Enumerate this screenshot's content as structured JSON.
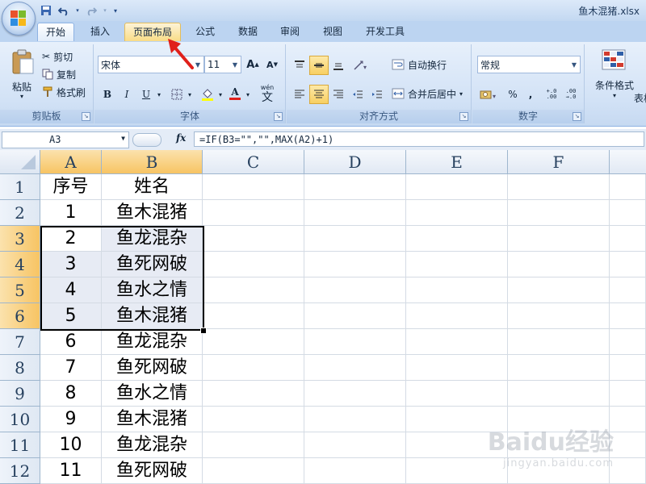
{
  "titlebar": {
    "filename": "鱼木混猪.xlsx"
  },
  "ribbon_tabs": [
    "开始",
    "插入",
    "页面布局",
    "公式",
    "数据",
    "审阅",
    "视图",
    "开发工具"
  ],
  "clipboard": {
    "paste": "粘贴",
    "cut": "剪切",
    "copy": "复制",
    "format_painter": "格式刷",
    "label": "剪贴板"
  },
  "font": {
    "name": "宋体",
    "size": "11",
    "grow": "A",
    "shrink": "A",
    "bold": "B",
    "italic": "I",
    "underline": "U",
    "font_color": "A",
    "phonetic": "wén",
    "phonetic_glyph": "文",
    "label": "字体"
  },
  "alignment": {
    "wrap_text": "自动换行",
    "merge_center": "合并后居中",
    "label": "对齐方式"
  },
  "number": {
    "format": "常规",
    "percent": "%",
    "comma": ",",
    "inc_decimal": "+.0\n.00",
    "dec_decimal": ".00\n→.0",
    "label": "数字"
  },
  "styles": {
    "conditional_format": "条件格式",
    "table_partial": "表格"
  },
  "formula_bar": {
    "name_box": "A3",
    "fx": "fx",
    "formula": "=IF(B3=\"\",\"\",MAX(A2)+1)"
  },
  "grid": {
    "columns": [
      "A",
      "B",
      "C",
      "D",
      "E",
      "F"
    ],
    "rows": [
      {
        "num": "1",
        "a": "序号",
        "b": "姓名"
      },
      {
        "num": "2",
        "a": "1",
        "b": "鱼木混猪"
      },
      {
        "num": "3",
        "a": "2",
        "b": "鱼龙混杂"
      },
      {
        "num": "4",
        "a": "3",
        "b": "鱼死网破"
      },
      {
        "num": "5",
        "a": "4",
        "b": "鱼水之情"
      },
      {
        "num": "6",
        "a": "5",
        "b": "鱼木混猪"
      },
      {
        "num": "7",
        "a": "6",
        "b": "鱼龙混杂"
      },
      {
        "num": "8",
        "a": "7",
        "b": "鱼死网破"
      },
      {
        "num": "9",
        "a": "8",
        "b": "鱼水之情"
      },
      {
        "num": "10",
        "a": "9",
        "b": "鱼木混猪"
      },
      {
        "num": "11",
        "a": "10",
        "b": "鱼龙混杂"
      },
      {
        "num": "12",
        "a": "11",
        "b": "鱼死网破"
      }
    ]
  },
  "watermark": {
    "main": "Baidu经验",
    "sub": "jingyan.baidu.com"
  },
  "colors": {
    "selection_fill": "#e7ebf4",
    "header_highlight": "#f7c463",
    "arrow": "#e0201b"
  }
}
